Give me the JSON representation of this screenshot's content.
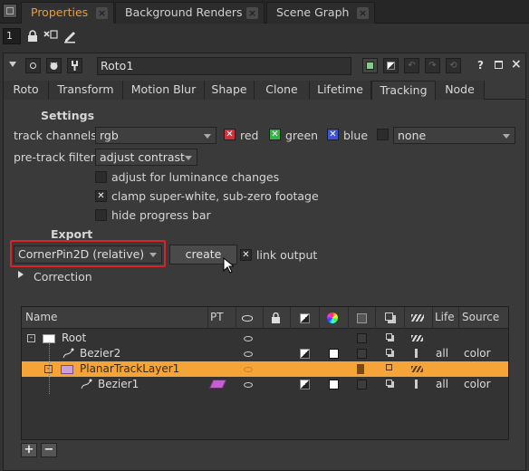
{
  "top_tabs": [
    {
      "label": "Properties",
      "active": true
    },
    {
      "label": "Background Renders",
      "active": false
    },
    {
      "label": "Scene Graph",
      "active": false
    }
  ],
  "toolbar": {
    "max_panels": "1"
  },
  "node": {
    "name": "Roto1"
  },
  "param_tabs": [
    "Roto",
    "Transform",
    "Motion Blur",
    "Shape",
    "Clone",
    "Lifetime",
    "Tracking",
    "Node"
  ],
  "active_param_tab": "Tracking",
  "settings": {
    "header": "Settings",
    "track_channels_label": "track channels",
    "track_channels_value": "rgb",
    "red_label": "red",
    "green_label": "green",
    "blue_label": "blue",
    "alpha_value": "none",
    "pretrack_label": "pre-track filter",
    "pretrack_value": "adjust contrast",
    "luminance_label": "adjust for luminance changes",
    "clamp_label": "clamp super-white, sub-zero footage",
    "hide_progress_label": "hide progress bar"
  },
  "export": {
    "header": "Export",
    "type_value": "CornerPin2D (relative)",
    "create_label": "create",
    "link_output_label": "link output",
    "correction_label": "Correction"
  },
  "layers_table": {
    "headers": {
      "name": "Name",
      "pt": "PT",
      "life": "Life",
      "source": "Source"
    },
    "rows": [
      {
        "name": "Root",
        "life": "",
        "source": ""
      },
      {
        "name": "Bezier2",
        "life": "all",
        "source": "color"
      },
      {
        "name": "PlanarTrackLayer1",
        "life": "",
        "source": ""
      },
      {
        "name": "Bezier1",
        "life": "all",
        "source": "color"
      }
    ]
  },
  "colors": {
    "accent": "#f39c2a",
    "selection": "#f5a437",
    "highlight_border": "#d8232a"
  }
}
